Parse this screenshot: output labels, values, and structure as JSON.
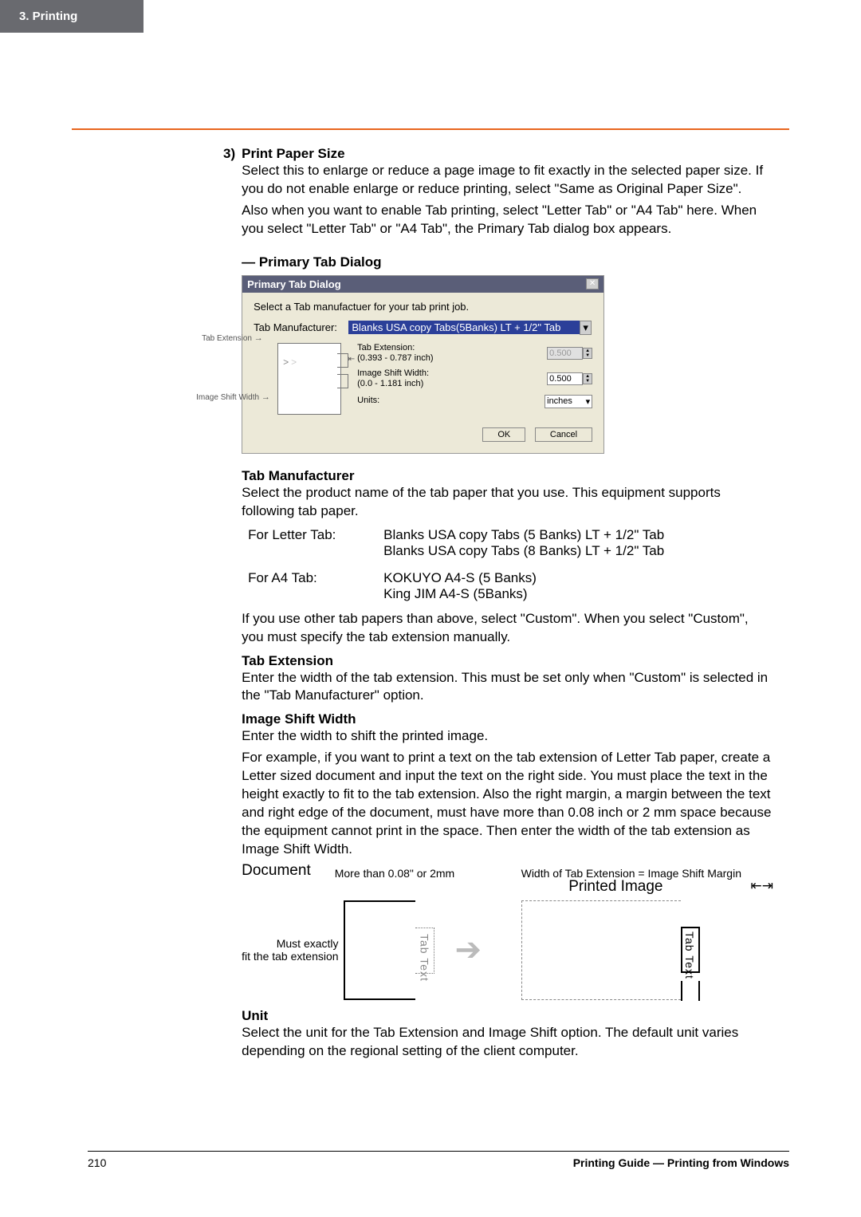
{
  "header": {
    "chapter": "3.  Printing"
  },
  "section3": {
    "number": "3)",
    "title": "Print Paper Size",
    "para1": "Select this to enlarge or reduce a page image to fit exactly in the selected paper size.  If you do not enable enlarge or reduce printing, select \"Same as Original Paper Size\".",
    "para2": "Also when you want to enable Tab printing, select \"Letter Tab\" or \"A4 Tab\" here.  When you select \"Letter Tab\" or \"A4 Tab\", the Primary Tab dialog box appears."
  },
  "primary_dialog": {
    "heading": "—  Primary Tab Dialog",
    "title": "Primary Tab Dialog",
    "instruction": "Select a Tab manufactuer for your tab print job.",
    "manufacturer_label": "Tab Manufacturer:",
    "manufacturer_value": "Blanks USA copy Tabs(5Banks) LT + 1/2\"  Tab",
    "tab_extension_text": "Tab Extension",
    "image_shift_text": "Image Shift Width",
    "tab_ext_label": "Tab Extension:",
    "tab_ext_range": "(0.393 - 0.787 inch)",
    "tab_ext_value": "0.500",
    "img_shift_label": "Image Shift Width:",
    "img_shift_range": "(0.0 - 1.181 inch)",
    "img_shift_value": "0.500",
    "units_label": "Units:",
    "units_value": "inches",
    "ok": "OK",
    "cancel": "Cancel"
  },
  "tab_manufacturer": {
    "title": "Tab Manufacturer",
    "text": "Select the product name of the tab paper that you use.  This equipment supports following tab paper.",
    "row1_label": "For Letter Tab:",
    "row1_v1": "Blanks USA copy Tabs (5 Banks) LT + 1/2\" Tab",
    "row1_v2": "Blanks USA copy Tabs (8 Banks) LT + 1/2\" Tab",
    "row2_label": "For A4 Tab:",
    "row2_v1": "KOKUYO A4-S  (5 Banks)",
    "row2_v2": "King JIM A4-S (5Banks)",
    "after": "If you use other tab papers than above, select \"Custom\".  When you select \"Custom\", you must specify the tab extension manually."
  },
  "tab_extension": {
    "title": "Tab Extension",
    "text": "Enter the width of the tab extension.  This must be set only when \"Custom\" is selected in the \"Tab Manufacturer\" option."
  },
  "image_shift": {
    "title": "Image Shift Width",
    "p1": "Enter the width to shift the printed image.",
    "p2": "For example, if you want to print a text on the tab extension of Letter Tab paper, create a Letter sized document and input the text on the right side.  You must place the text in the height exactly to fit to the tab extension.  Also the right margin, a margin between the text and right edge of the document, must have more than 0.08 inch or 2 mm space because the equipment cannot print in the space.  Then enter the width of the tab extension as Image Shift Width."
  },
  "diagram": {
    "doc_label": "Document",
    "more_than": "More than 0.08\" or 2mm",
    "must_exactly": "Must exactly",
    "fit_ext": "fit the tab extension",
    "tab_text": "Tab Text",
    "width_note": "Width of Tab Extension = Image Shift Margin",
    "printed_label": "Printed Image"
  },
  "unit": {
    "title": "Unit",
    "text": "Select the unit for the Tab Extension and Image Shift option.  The default unit varies depending on the regional setting of the client computer."
  },
  "footer": {
    "page": "210",
    "right": "Printing Guide — Printing from Windows"
  }
}
